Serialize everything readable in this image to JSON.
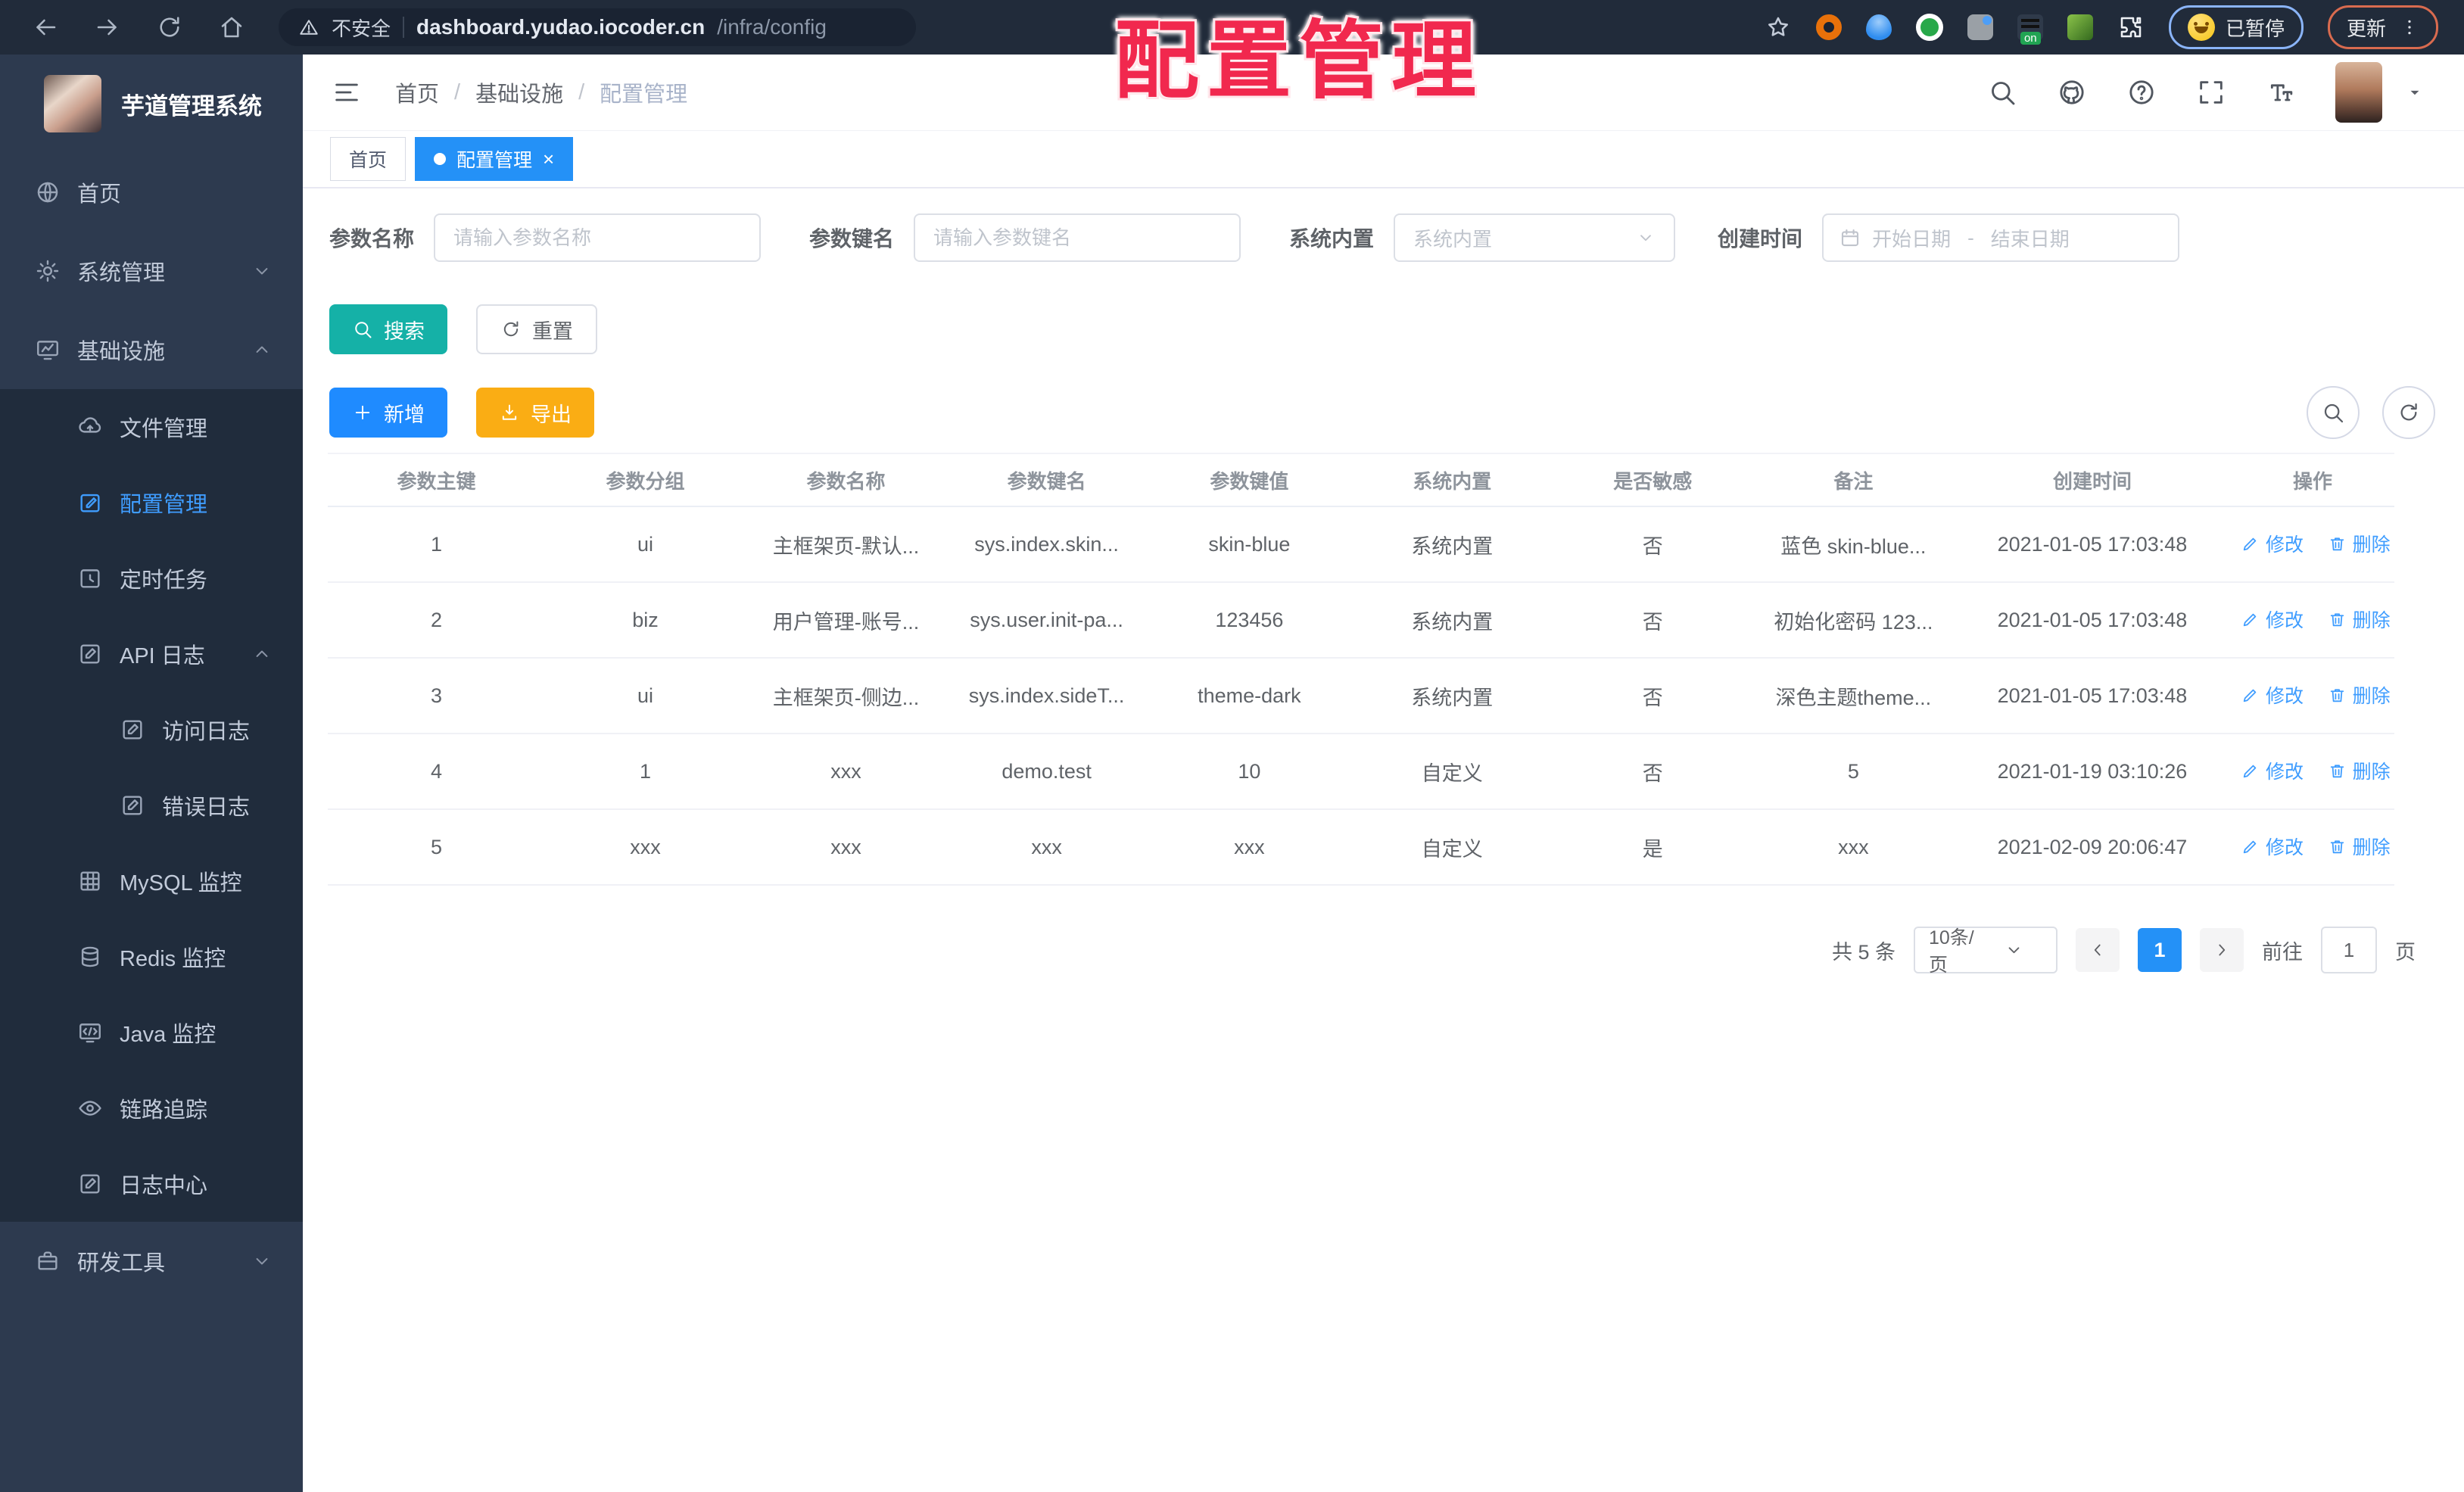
{
  "browser": {
    "security_label": "不安全",
    "url_host": "dashboard.yudao.iocoder.cn",
    "url_path": "/infra/config",
    "paused_chip_label": "已暂停",
    "update_button_label": "更新",
    "extension_icons": [
      "bookmark-star-icon",
      "orange-ring-extension-icon",
      "blue-pin-extension-icon",
      "green-circle-extension-icon",
      "gray-tile-extension-icon",
      "dark-on-badge-extension-icon",
      "green-leaf-extension-icon",
      "extensions-puzzle-icon"
    ]
  },
  "overlay": {
    "stamp_text": "配置管理",
    "stamp_color": "#f1284e"
  },
  "sidebar": {
    "app_title": "芋道管理系统",
    "items": [
      {
        "label": "首页",
        "icon": "globe-icon",
        "level": 1,
        "sub": false,
        "active": false,
        "chevron": null
      },
      {
        "label": "系统管理",
        "icon": "gear-icon",
        "level": 1,
        "sub": false,
        "active": false,
        "chevron": "down"
      },
      {
        "label": "基础设施",
        "icon": "monitor-icon",
        "level": 1,
        "sub": false,
        "active": false,
        "chevron": "up"
      },
      {
        "label": "文件管理",
        "icon": "cloud-icon",
        "level": 2,
        "sub": true,
        "active": false,
        "chevron": null
      },
      {
        "label": "配置管理",
        "icon": "edit-icon",
        "level": 2,
        "sub": true,
        "active": true,
        "chevron": null
      },
      {
        "label": "定时任务",
        "icon": "clock-icon",
        "level": 2,
        "sub": true,
        "active": false,
        "chevron": null
      },
      {
        "label": "API 日志",
        "icon": "logdoc-icon",
        "level": 2,
        "sub": true,
        "active": false,
        "chevron": "up"
      },
      {
        "label": "访问日志",
        "icon": "logdoc-icon",
        "level": 3,
        "sub": true,
        "active": false,
        "chevron": null
      },
      {
        "label": "错误日志",
        "icon": "logdoc-icon",
        "level": 3,
        "sub": true,
        "active": false,
        "chevron": null
      },
      {
        "label": "MySQL 监控",
        "icon": "grid-icon",
        "level": 2,
        "sub": true,
        "active": false,
        "chevron": null
      },
      {
        "label": "Redis 监控",
        "icon": "db-icon",
        "level": 2,
        "sub": true,
        "active": false,
        "chevron": null
      },
      {
        "label": "Java 监控",
        "icon": "screen-icon",
        "level": 2,
        "sub": true,
        "active": false,
        "chevron": null
      },
      {
        "label": "链路追踪",
        "icon": "eye-icon",
        "level": 2,
        "sub": true,
        "active": false,
        "chevron": null
      },
      {
        "label": "日志中心",
        "icon": "logdoc-icon",
        "level": 2,
        "sub": true,
        "active": false,
        "chevron": null
      },
      {
        "label": "研发工具",
        "icon": "briefcase-icon",
        "level": 1,
        "sub": false,
        "active": false,
        "chevron": "down"
      }
    ]
  },
  "header": {
    "breadcrumb": [
      "首页",
      "基础设施",
      "配置管理"
    ],
    "breadcrumb_separator": "/",
    "icons": [
      "search-icon",
      "github-icon",
      "question-icon",
      "fullscreen-icon",
      "fontsize-icon",
      "avatar",
      "caret-down-icon"
    ]
  },
  "tabs": [
    {
      "label": "首页",
      "active": false
    },
    {
      "label": "配置管理",
      "active": true,
      "close": "×"
    }
  ],
  "filters": {
    "name_label": "参数名称",
    "name_placeholder": "请输入参数名称",
    "key_label": "参数键名",
    "key_placeholder": "请输入参数键名",
    "type_label": "系统内置",
    "type_placeholder": "系统内置",
    "date_label": "创建时间",
    "date_start_placeholder": "开始日期",
    "date_separator": "-",
    "date_end_placeholder": "结束日期",
    "search_label": "搜索",
    "reset_label": "重置"
  },
  "toolbar": {
    "add_label": "新增",
    "export_label": "导出"
  },
  "table": {
    "headers": [
      "参数主键",
      "参数分组",
      "参数名称",
      "参数键名",
      "参数键值",
      "系统内置",
      "是否敏感",
      "备注",
      "创建时间",
      "操作"
    ],
    "edit_label": "修改",
    "delete_label": "删除",
    "rows": [
      {
        "id": "1",
        "group": "ui",
        "name": "主框架页-默认...",
        "key": "sys.index.skin...",
        "value": "skin-blue",
        "builtin": "系统内置",
        "sensitive": "否",
        "remark": "蓝色 skin-blue...",
        "created": "2021-01-05 17:03:48"
      },
      {
        "id": "2",
        "group": "biz",
        "name": "用户管理-账号...",
        "key": "sys.user.init-pa...",
        "value": "123456",
        "builtin": "系统内置",
        "sensitive": "否",
        "remark": "初始化密码 123...",
        "created": "2021-01-05 17:03:48"
      },
      {
        "id": "3",
        "group": "ui",
        "name": "主框架页-侧边...",
        "key": "sys.index.sideT...",
        "value": "theme-dark",
        "builtin": "系统内置",
        "sensitive": "否",
        "remark": "深色主题theme...",
        "created": "2021-01-05 17:03:48"
      },
      {
        "id": "4",
        "group": "1",
        "name": "xxx",
        "key": "demo.test",
        "value": "10",
        "builtin": "自定义",
        "sensitive": "否",
        "remark": "5",
        "created": "2021-01-19 03:10:26"
      },
      {
        "id": "5",
        "group": "xxx",
        "name": "xxx",
        "key": "xxx",
        "value": "xxx",
        "builtin": "自定义",
        "sensitive": "是",
        "remark": "xxx",
        "created": "2021-02-09 20:06:47"
      }
    ]
  },
  "pagination": {
    "total_text": "共 5 条",
    "page_size": "10条/页",
    "current_page": "1",
    "goto_label": "前往",
    "goto_value": "1",
    "page_unit": "页"
  }
}
